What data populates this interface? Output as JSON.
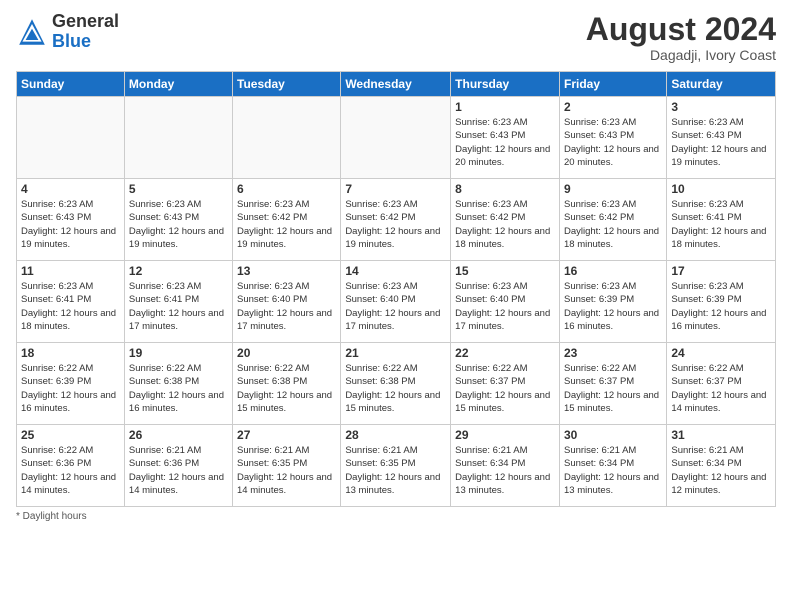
{
  "header": {
    "logo_general": "General",
    "logo_blue": "Blue",
    "month_year": "August 2024",
    "location": "Dagadji, Ivory Coast"
  },
  "days_of_week": [
    "Sunday",
    "Monday",
    "Tuesday",
    "Wednesday",
    "Thursday",
    "Friday",
    "Saturday"
  ],
  "weeks": [
    [
      {
        "day": "",
        "info": ""
      },
      {
        "day": "",
        "info": ""
      },
      {
        "day": "",
        "info": ""
      },
      {
        "day": "",
        "info": ""
      },
      {
        "day": "1",
        "info": "Sunrise: 6:23 AM\nSunset: 6:43 PM\nDaylight: 12 hours and 20 minutes."
      },
      {
        "day": "2",
        "info": "Sunrise: 6:23 AM\nSunset: 6:43 PM\nDaylight: 12 hours and 20 minutes."
      },
      {
        "day": "3",
        "info": "Sunrise: 6:23 AM\nSunset: 6:43 PM\nDaylight: 12 hours and 19 minutes."
      }
    ],
    [
      {
        "day": "4",
        "info": "Sunrise: 6:23 AM\nSunset: 6:43 PM\nDaylight: 12 hours and 19 minutes."
      },
      {
        "day": "5",
        "info": "Sunrise: 6:23 AM\nSunset: 6:43 PM\nDaylight: 12 hours and 19 minutes."
      },
      {
        "day": "6",
        "info": "Sunrise: 6:23 AM\nSunset: 6:42 PM\nDaylight: 12 hours and 19 minutes."
      },
      {
        "day": "7",
        "info": "Sunrise: 6:23 AM\nSunset: 6:42 PM\nDaylight: 12 hours and 19 minutes."
      },
      {
        "day": "8",
        "info": "Sunrise: 6:23 AM\nSunset: 6:42 PM\nDaylight: 12 hours and 18 minutes."
      },
      {
        "day": "9",
        "info": "Sunrise: 6:23 AM\nSunset: 6:42 PM\nDaylight: 12 hours and 18 minutes."
      },
      {
        "day": "10",
        "info": "Sunrise: 6:23 AM\nSunset: 6:41 PM\nDaylight: 12 hours and 18 minutes."
      }
    ],
    [
      {
        "day": "11",
        "info": "Sunrise: 6:23 AM\nSunset: 6:41 PM\nDaylight: 12 hours and 18 minutes."
      },
      {
        "day": "12",
        "info": "Sunrise: 6:23 AM\nSunset: 6:41 PM\nDaylight: 12 hours and 17 minutes."
      },
      {
        "day": "13",
        "info": "Sunrise: 6:23 AM\nSunset: 6:40 PM\nDaylight: 12 hours and 17 minutes."
      },
      {
        "day": "14",
        "info": "Sunrise: 6:23 AM\nSunset: 6:40 PM\nDaylight: 12 hours and 17 minutes."
      },
      {
        "day": "15",
        "info": "Sunrise: 6:23 AM\nSunset: 6:40 PM\nDaylight: 12 hours and 17 minutes."
      },
      {
        "day": "16",
        "info": "Sunrise: 6:23 AM\nSunset: 6:39 PM\nDaylight: 12 hours and 16 minutes."
      },
      {
        "day": "17",
        "info": "Sunrise: 6:23 AM\nSunset: 6:39 PM\nDaylight: 12 hours and 16 minutes."
      }
    ],
    [
      {
        "day": "18",
        "info": "Sunrise: 6:22 AM\nSunset: 6:39 PM\nDaylight: 12 hours and 16 minutes."
      },
      {
        "day": "19",
        "info": "Sunrise: 6:22 AM\nSunset: 6:38 PM\nDaylight: 12 hours and 16 minutes."
      },
      {
        "day": "20",
        "info": "Sunrise: 6:22 AM\nSunset: 6:38 PM\nDaylight: 12 hours and 15 minutes."
      },
      {
        "day": "21",
        "info": "Sunrise: 6:22 AM\nSunset: 6:38 PM\nDaylight: 12 hours and 15 minutes."
      },
      {
        "day": "22",
        "info": "Sunrise: 6:22 AM\nSunset: 6:37 PM\nDaylight: 12 hours and 15 minutes."
      },
      {
        "day": "23",
        "info": "Sunrise: 6:22 AM\nSunset: 6:37 PM\nDaylight: 12 hours and 15 minutes."
      },
      {
        "day": "24",
        "info": "Sunrise: 6:22 AM\nSunset: 6:37 PM\nDaylight: 12 hours and 14 minutes."
      }
    ],
    [
      {
        "day": "25",
        "info": "Sunrise: 6:22 AM\nSunset: 6:36 PM\nDaylight: 12 hours and 14 minutes."
      },
      {
        "day": "26",
        "info": "Sunrise: 6:21 AM\nSunset: 6:36 PM\nDaylight: 12 hours and 14 minutes."
      },
      {
        "day": "27",
        "info": "Sunrise: 6:21 AM\nSunset: 6:35 PM\nDaylight: 12 hours and 14 minutes."
      },
      {
        "day": "28",
        "info": "Sunrise: 6:21 AM\nSunset: 6:35 PM\nDaylight: 12 hours and 13 minutes."
      },
      {
        "day": "29",
        "info": "Sunrise: 6:21 AM\nSunset: 6:34 PM\nDaylight: 12 hours and 13 minutes."
      },
      {
        "day": "30",
        "info": "Sunrise: 6:21 AM\nSunset: 6:34 PM\nDaylight: 12 hours and 13 minutes."
      },
      {
        "day": "31",
        "info": "Sunrise: 6:21 AM\nSunset: 6:34 PM\nDaylight: 12 hours and 12 minutes."
      }
    ]
  ],
  "footer": {
    "daylight_hours_label": "Daylight hours"
  }
}
